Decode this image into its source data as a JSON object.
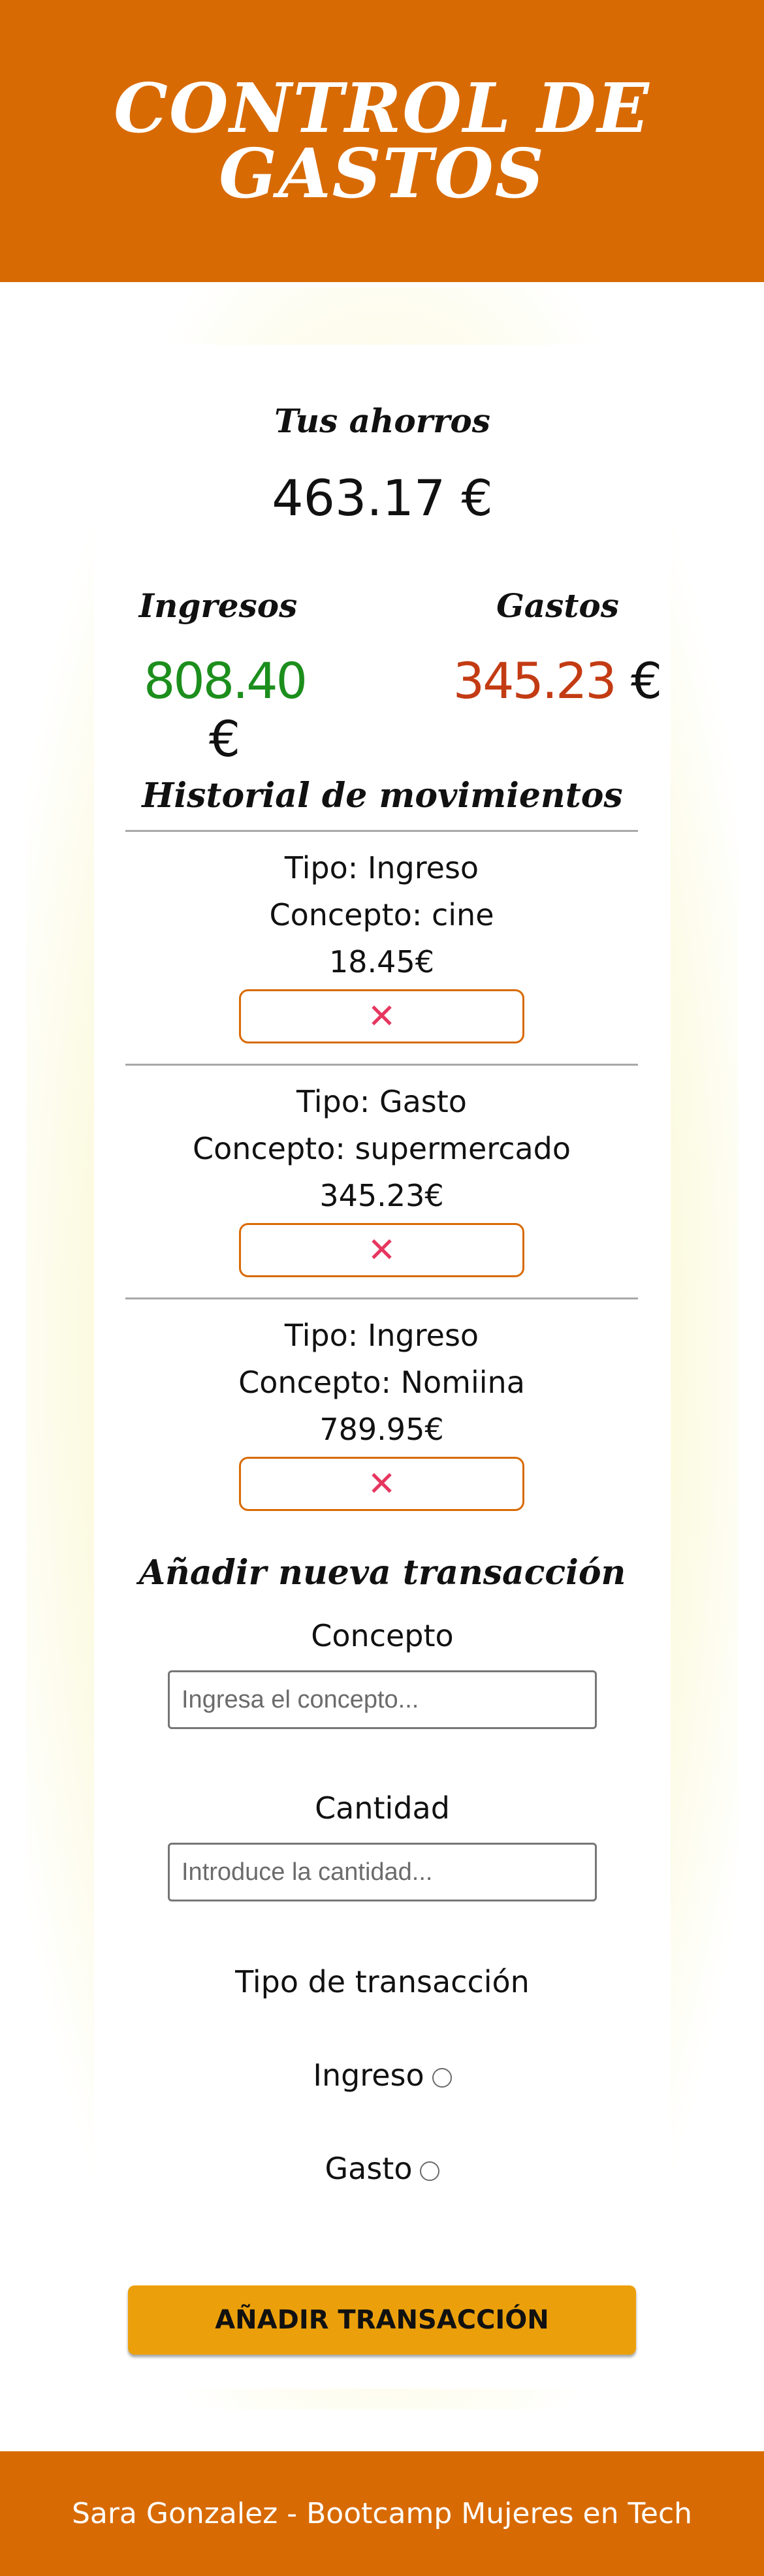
{
  "header": {
    "title": "CONTROL DE GASTOS"
  },
  "summary": {
    "savings_label": "Tus ahorros",
    "savings_value": "463.17 €",
    "income_label": "Ingresos",
    "income_value": "808.40",
    "expense_label": "Gastos",
    "expense_value": "345.23",
    "currency": "€"
  },
  "history": {
    "title": "Historial de movimientos",
    "items": [
      {
        "type": "Tipo: Ingreso",
        "concept": "Concepto: cine",
        "amount": "18.45€",
        "delete_icon": "close-icon"
      },
      {
        "type": "Tipo: Gasto",
        "concept": "Concepto: supermercado",
        "amount": "345.23€",
        "delete_icon": "close-icon"
      },
      {
        "type": "Tipo: Ingreso",
        "concept": "Concepto: Nomiina",
        "amount": "789.95€",
        "delete_icon": "close-icon"
      }
    ]
  },
  "form": {
    "title": "Añadir nueva transacción",
    "concept_label": "Concepto",
    "concept_placeholder": "Ingresa el concepto...",
    "amount_label": "Cantidad",
    "amount_placeholder": "Introduce la cantidad...",
    "type_label": "Tipo de transacción",
    "option_income": "Ingreso",
    "option_expense": "Gasto",
    "submit_label": "AÑADIR TRANSACCIÓN"
  },
  "footer": {
    "text": "Sara Gonzalez - Bootcamp Mujeres en Tech"
  },
  "colors": {
    "header": "#d86a03",
    "income": "#1c8e1c",
    "expense": "#c33b13",
    "delete": "#e6365f",
    "submit": "#eba00b"
  }
}
